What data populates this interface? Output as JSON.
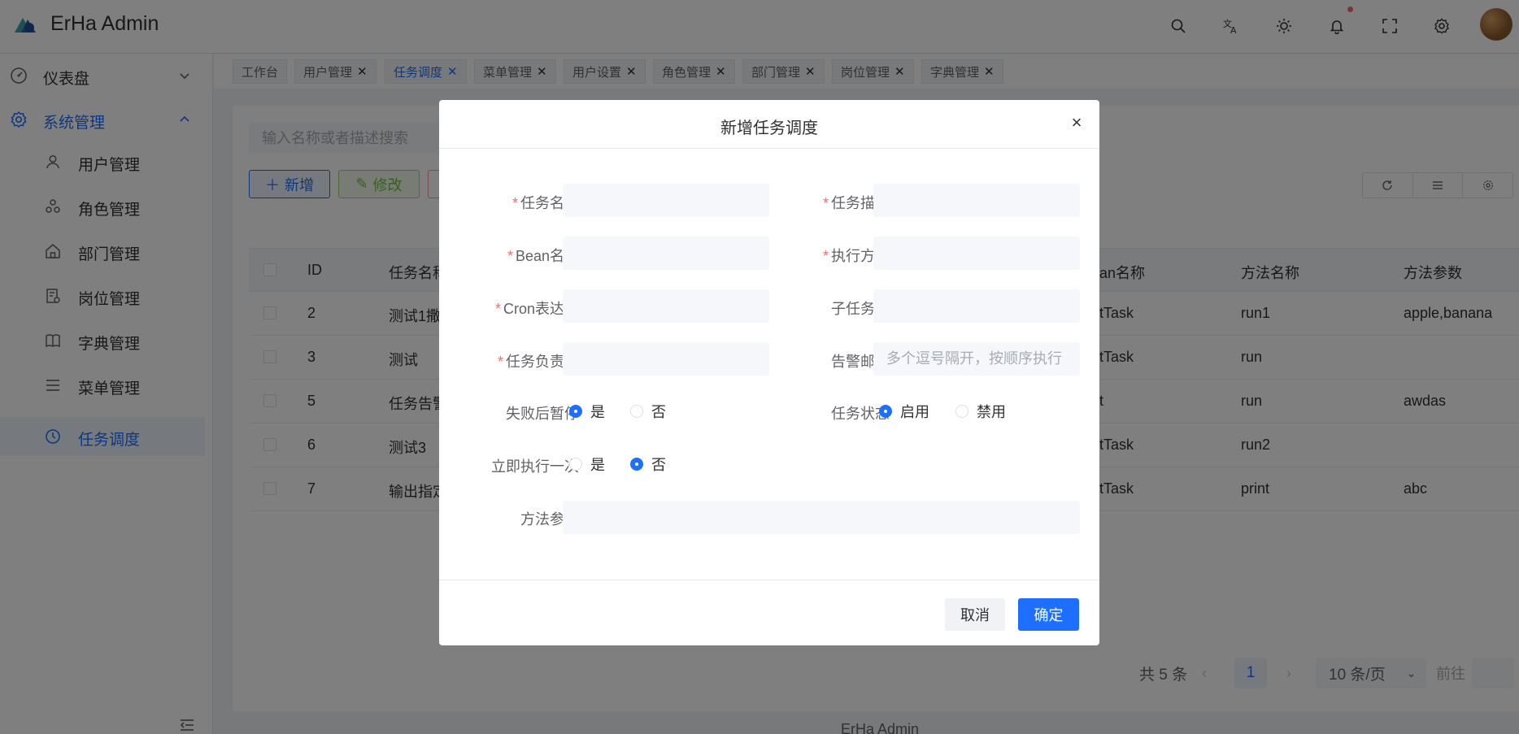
{
  "app": {
    "title": "ErHa Admin",
    "brand_color": "#1e6fff"
  },
  "header": {
    "icons": [
      "search-icon",
      "translate-icon",
      "theme-sun-icon",
      "bell-icon",
      "fullscreen-icon",
      "gear-icon"
    ]
  },
  "sidebar": {
    "dashboard": {
      "label": "仪表盘",
      "icon": "dashboard-icon"
    },
    "system": {
      "label": "系统管理",
      "icon": "gear-icon"
    },
    "items": [
      {
        "label": "用户管理",
        "icon": "user-icon"
      },
      {
        "label": "角色管理",
        "icon": "role-icon"
      },
      {
        "label": "部门管理",
        "icon": "home-icon"
      },
      {
        "label": "岗位管理",
        "icon": "post-icon"
      },
      {
        "label": "字典管理",
        "icon": "book-icon"
      },
      {
        "label": "菜单管理",
        "icon": "menu-icon"
      },
      {
        "label": "任务调度",
        "icon": "clock-icon"
      }
    ]
  },
  "tags": [
    "工作台",
    "用户管理",
    "任务调度",
    "菜单管理",
    "用户设置",
    "角色管理",
    "部门管理",
    "岗位管理",
    "字典管理"
  ],
  "toolbar": {
    "search_placeholder": "输入名称或者描述搜索",
    "add_label": "新增",
    "edit_label": "修改"
  },
  "table": {
    "headers": {
      "id": "ID",
      "name": "任务名称",
      "bean": "an名称",
      "method": "方法名称",
      "params": "方法参数"
    },
    "rows": [
      {
        "id": "2",
        "name": "测试1撒",
        "bean": "tTask",
        "method": "run1",
        "params": "apple,banana"
      },
      {
        "id": "3",
        "name": "测试",
        "bean": "tTask",
        "method": "run",
        "params": ""
      },
      {
        "id": "5",
        "name": "任务告警",
        "bean": "t",
        "method": "run",
        "params": "awdas"
      },
      {
        "id": "6",
        "name": "测试3",
        "bean": "tTask",
        "method": "run2",
        "params": ""
      },
      {
        "id": "7",
        "name": "输出指定",
        "bean": "tTask",
        "method": "print",
        "params": "abc"
      }
    ]
  },
  "pager": {
    "total": "共 5 条",
    "current": "1",
    "page_size": "10 条/页",
    "jump": "前往"
  },
  "footer": "ErHa Admin",
  "dialog": {
    "title": "新增任务调度",
    "fields": {
      "task_name": {
        "label": "任务名称",
        "value": "",
        "placeholder": ""
      },
      "task_desc": {
        "label": "任务描述",
        "value": "",
        "placeholder": ""
      },
      "bean_name": {
        "label": "Bean名称",
        "value": "",
        "placeholder": ""
      },
      "exec_method": {
        "label": "执行方法",
        "value": "",
        "placeholder": ""
      },
      "cron": {
        "label": "Cron表达式",
        "value": "",
        "placeholder": ""
      },
      "sub_task_id": {
        "label": "子任务ID",
        "value": "",
        "placeholder": ""
      },
      "owner": {
        "label": "任务负责人",
        "value": "",
        "placeholder": ""
      },
      "alert_email": {
        "label": "告警邮箱",
        "value": "",
        "placeholder": "多个逗号隔开，按顺序执行"
      },
      "pause_on_fail": {
        "label": "失败后暂停",
        "options": [
          "是",
          "否"
        ],
        "selected": "是"
      },
      "task_status": {
        "label": "任务状态",
        "options": [
          "启用",
          "禁用"
        ],
        "selected": "启用"
      },
      "run_once": {
        "label": "立即执行一次",
        "options": [
          "是",
          "否"
        ],
        "selected": "否"
      },
      "method_params": {
        "label": "方法参数",
        "value": "",
        "placeholder": ""
      }
    },
    "cancel_label": "取消",
    "ok_label": "确定"
  }
}
